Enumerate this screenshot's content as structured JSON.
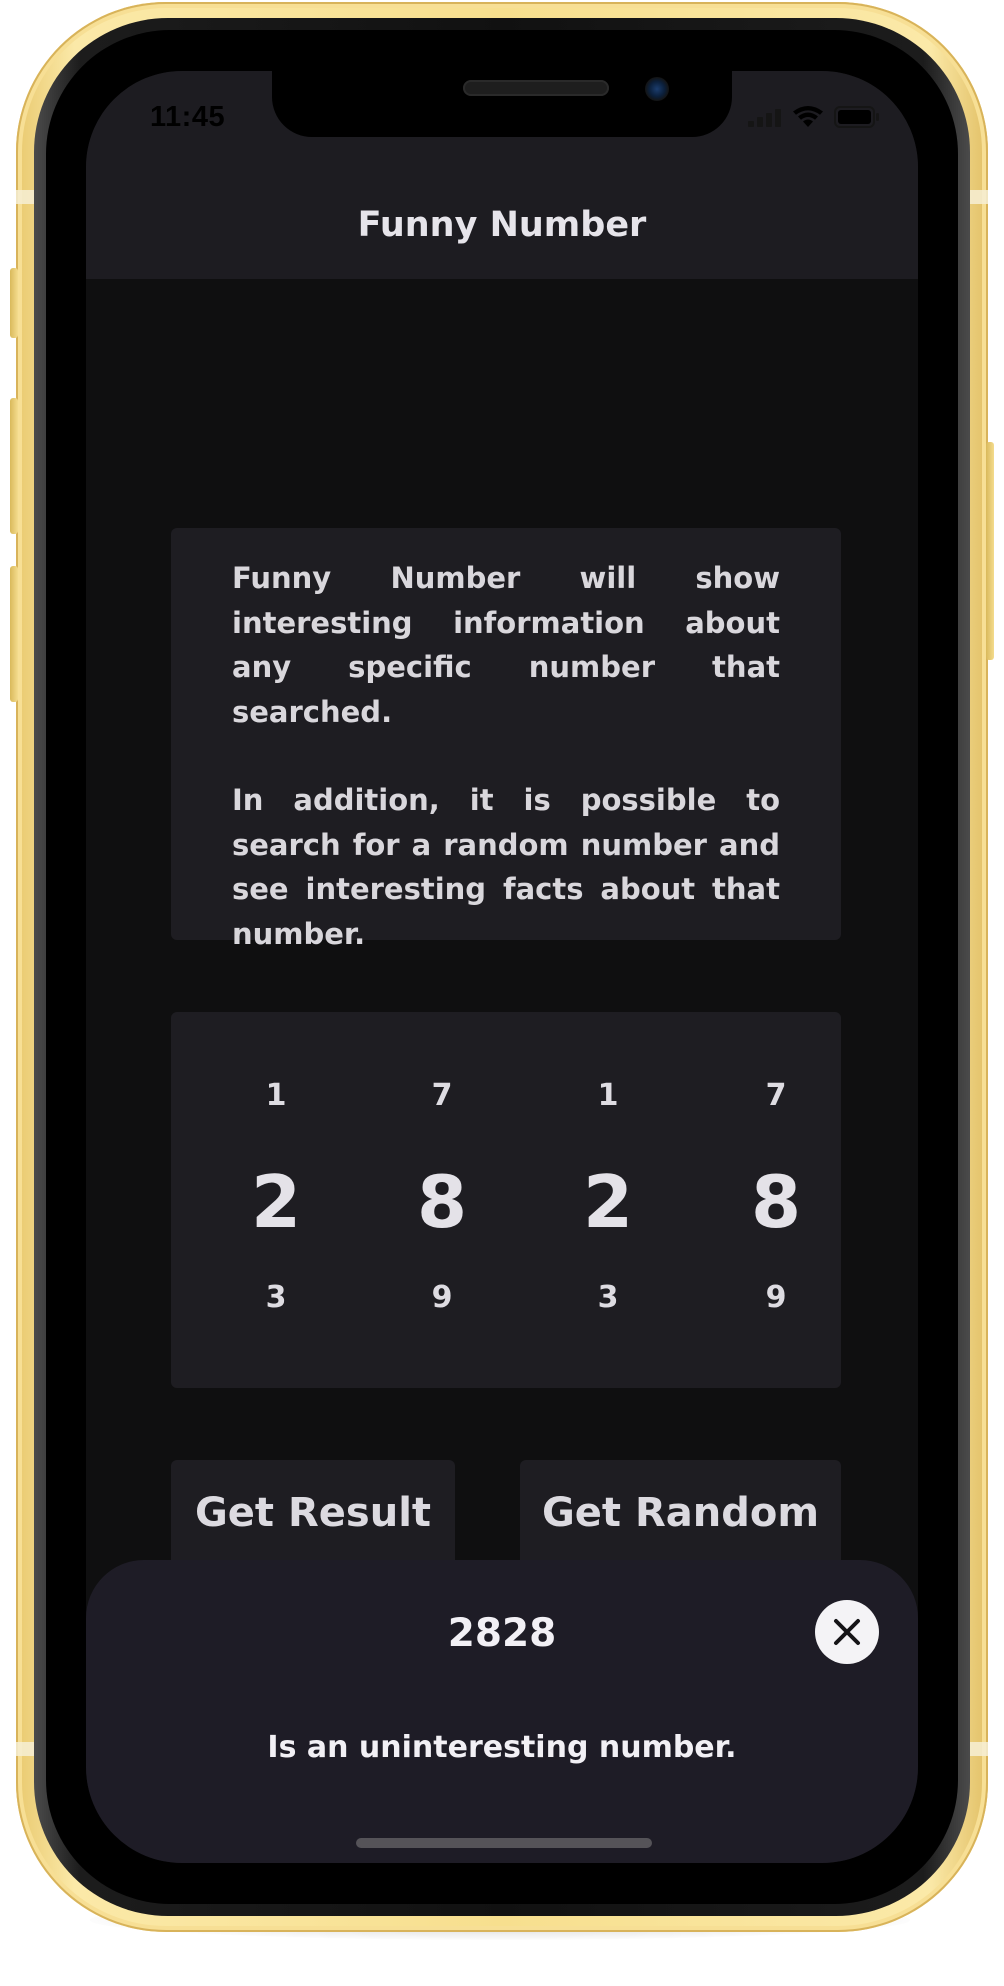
{
  "status_bar": {
    "time": "11:45",
    "icons": [
      "signal-icon",
      "wifi-icon",
      "battery-icon"
    ]
  },
  "nav": {
    "title": "Funny Number"
  },
  "description": {
    "paragraph_1": "Funny Number will show interesting information about any specific number that searched.",
    "paragraph_2": "In addition, it is possible to search for a random number and see interesting facts about that number."
  },
  "picker": {
    "columns": [
      {
        "above": "1",
        "selected": "2",
        "below": "3"
      },
      {
        "above": "7",
        "selected": "8",
        "below": "9"
      },
      {
        "above": "1",
        "selected": "2",
        "below": "3"
      },
      {
        "above": "7",
        "selected": "8",
        "below": "9"
      }
    ]
  },
  "buttons": {
    "get_result": "Get Result",
    "get_random": "Get Random"
  },
  "result_sheet": {
    "number": "2828",
    "message": "Is an uninteresting number.",
    "close_icon": "close-icon"
  },
  "colors": {
    "background": "#0f0f10",
    "nav_bar": "#1d1c21",
    "card": "#1e1d22",
    "sheet": "#1e1c26",
    "text": "#e4e2e8",
    "device_frame": "#f7df8e"
  }
}
